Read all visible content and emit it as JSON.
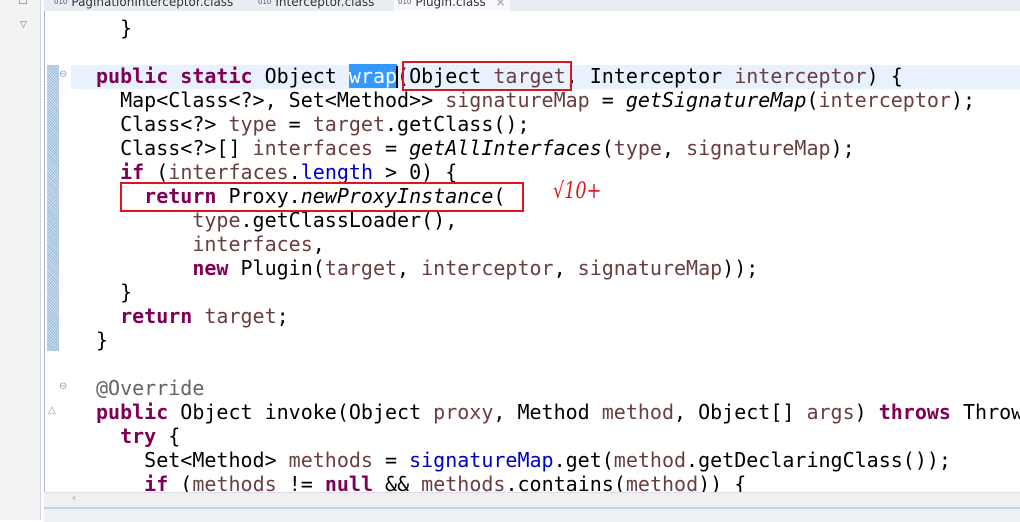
{
  "tabs": [
    {
      "label": "PaginationInterceptor.class",
      "icon": "class-file-icon",
      "active": false
    },
    {
      "label": "Interceptor.class",
      "icon": "class-file-icon",
      "active": false
    },
    {
      "label": "Plugin.class",
      "icon": "class-file-icon",
      "active": true,
      "close": "⨯"
    }
  ],
  "editor": {
    "lines": [
      [
        [
          "  }",
          ""
        ]
      ],
      [],
      [
        [
          "public",
          "kw"
        ],
        [
          " ",
          ""
        ],
        [
          "static",
          "kw"
        ],
        [
          " Object ",
          ""
        ],
        [
          "wrap",
          "sel"
        ],
        [
          "(Object ",
          ""
        ],
        [
          "target",
          "var"
        ],
        [
          ", Interceptor ",
          ""
        ],
        [
          "interceptor",
          "var"
        ],
        [
          ") {",
          ""
        ]
      ],
      [
        [
          "  Map<Class<?>, Set<Method>> ",
          ""
        ],
        [
          "signatureMap",
          "var"
        ],
        [
          " = ",
          ""
        ],
        [
          "getSignatureMap",
          "it"
        ],
        [
          "(",
          ""
        ],
        [
          "interceptor",
          "var"
        ],
        [
          ");",
          ""
        ]
      ],
      [
        [
          "  Class<?> ",
          ""
        ],
        [
          "type",
          "var"
        ],
        [
          " = ",
          ""
        ],
        [
          "target",
          "var"
        ],
        [
          ".getClass();",
          ""
        ]
      ],
      [
        [
          "  Class<?>[] ",
          ""
        ],
        [
          "interfaces",
          "var"
        ],
        [
          " = ",
          ""
        ],
        [
          "getAllInterfaces",
          "it"
        ],
        [
          "(",
          ""
        ],
        [
          "type",
          "var"
        ],
        [
          ", ",
          ""
        ],
        [
          "signatureMap",
          "var"
        ],
        [
          ");",
          ""
        ]
      ],
      [
        [
          "  ",
          ""
        ],
        [
          "if",
          "kw"
        ],
        [
          " (",
          ""
        ],
        [
          "interfaces",
          "var"
        ],
        [
          ".",
          ""
        ],
        [
          "length",
          "fld"
        ],
        [
          " > 0) {",
          ""
        ]
      ],
      [
        [
          "    ",
          ""
        ],
        [
          "return",
          "kw"
        ],
        [
          " Proxy.",
          ""
        ],
        [
          "newProxyInstance",
          "it"
        ],
        [
          "(",
          ""
        ]
      ],
      [
        [
          "        ",
          ""
        ],
        [
          "type",
          "var"
        ],
        [
          ".getClassLoader(),",
          ""
        ]
      ],
      [
        [
          "        ",
          ""
        ],
        [
          "interfaces",
          "var"
        ],
        [
          ",",
          ""
        ]
      ],
      [
        [
          "        ",
          ""
        ],
        [
          "new",
          "kw"
        ],
        [
          " Plugin(",
          ""
        ],
        [
          "target",
          "var"
        ],
        [
          ", ",
          ""
        ],
        [
          "interceptor",
          "var"
        ],
        [
          ", ",
          ""
        ],
        [
          "signatureMap",
          "var"
        ],
        [
          "));",
          ""
        ]
      ],
      [
        [
          "  }",
          ""
        ]
      ],
      [
        [
          "  ",
          ""
        ],
        [
          "return",
          "kw"
        ],
        [
          " ",
          ""
        ],
        [
          "target",
          "var"
        ],
        [
          ";",
          ""
        ]
      ],
      [
        [
          "}",
          ""
        ]
      ],
      [],
      [
        [
          "@Override",
          "ann"
        ]
      ],
      [
        [
          "public",
          "kw"
        ],
        [
          " Object invoke(Object ",
          ""
        ],
        [
          "proxy",
          "var"
        ],
        [
          ", Method ",
          ""
        ],
        [
          "method",
          "var"
        ],
        [
          ", Object[] ",
          ""
        ],
        [
          "args",
          "var"
        ],
        [
          ") ",
          ""
        ],
        [
          "throws",
          "kw"
        ],
        [
          " Throwable {",
          ""
        ]
      ],
      [
        [
          "  ",
          ""
        ],
        [
          "try",
          "kw"
        ],
        [
          " {",
          ""
        ]
      ],
      [
        [
          "    Set<Method> ",
          ""
        ],
        [
          "methods",
          "var"
        ],
        [
          " = ",
          ""
        ],
        [
          "signatureMap",
          "fld"
        ],
        [
          ".get(",
          ""
        ],
        [
          "method",
          "var"
        ],
        [
          ".getDeclaringClass());",
          ""
        ]
      ],
      [
        [
          "    ",
          ""
        ],
        [
          "if",
          "kw"
        ],
        [
          " (",
          ""
        ],
        [
          "methods",
          "var"
        ],
        [
          " != ",
          ""
        ],
        [
          "null",
          "kw"
        ],
        [
          " && ",
          ""
        ],
        [
          "methods",
          "var"
        ],
        [
          ".contains(",
          ""
        ],
        [
          "method",
          "var"
        ],
        [
          ")) {",
          ""
        ]
      ]
    ],
    "annotation_handwriting": "√10+"
  },
  "colors": {
    "keyword": "#7f0055",
    "variable": "#6a3e3e",
    "field": "#0000c0",
    "annotation": "#646464",
    "highlight_box": "#e0141e",
    "selection": "#3399ff"
  }
}
